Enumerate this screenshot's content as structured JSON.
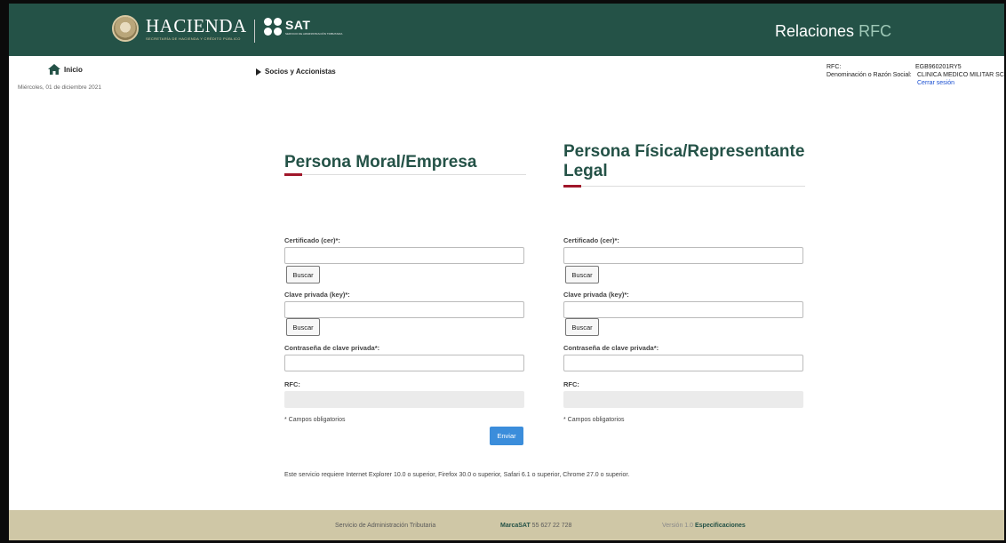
{
  "header": {
    "hacienda_word": "HACIENDA",
    "hacienda_sub": "SECRETARÍA DE HACIENDA Y CRÉDITO PÚBLICO",
    "sat_word": "SAT",
    "sat_sub": "SERVICIO DE ADMINISTRACIÓN TRIBUTARIA",
    "app_title_main": "Relaciones",
    "app_title_accent": "RFC"
  },
  "subheader": {
    "home_label": "Inicio",
    "date": "Miércoles, 01 de diciembre 2021",
    "nav_link": "Socios y Accionistas"
  },
  "user": {
    "rfc_label": "RFC:",
    "rfc_value": "EGB960201RY5",
    "name_label": "Denominación o Razón Social:",
    "name_value": "CLINICA MEDICO MILITAR SC",
    "logout": "Cerrar sesión"
  },
  "moral": {
    "title": "Persona Moral/Empresa",
    "cert_label": "Certificado (cer)*:",
    "key_label": "Clave privada (key)*:",
    "pass_label": "Contraseña de clave privada*:",
    "rfc_label": "RFC:",
    "browse": "Buscar",
    "required_note": "* Campos obligatorios",
    "send": "Enviar"
  },
  "fisica": {
    "title": "Persona Física/Representante Legal",
    "cert_label": "Certificado (cer)*:",
    "key_label": "Clave privada (key)*:",
    "pass_label": "Contraseña de clave privada*:",
    "rfc_label": "RFC:",
    "browse": "Buscar",
    "required_note": "* Campos obligatorios"
  },
  "notice": "Este servicio requiere Internet Explorer 10.0 o superior, Firefox 30.0 o superior, Safari 6.1 o superior, Chrome 27.0 o superior.",
  "footer": {
    "org": "Servicio de Administración Tributaria",
    "marca_label": "MarcaSAT",
    "marca_phone": "55 627 22 728",
    "version": "Versión 1.0",
    "specs": "Especificaciones"
  },
  "colors": {
    "header_bg": "#245247",
    "footer_bg": "#cfc7a6",
    "accent_red": "#a0162a",
    "primary_button": "#3b8ddb"
  }
}
